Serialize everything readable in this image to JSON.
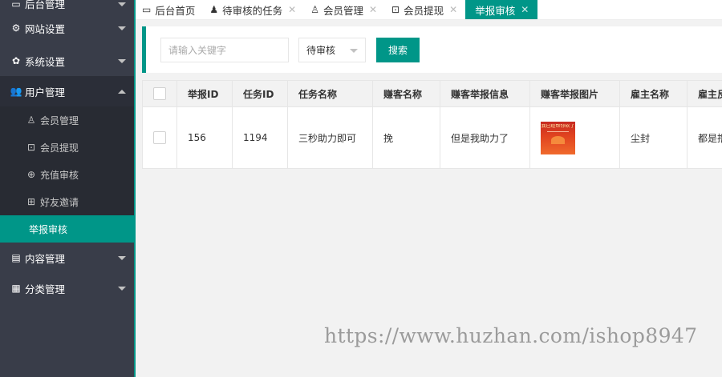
{
  "sidebar": {
    "items": [
      {
        "label": "后台管理",
        "icon": "monitor-icon"
      },
      {
        "label": "网站设置",
        "icon": "gears-icon"
      },
      {
        "label": "系统设置",
        "icon": "gear-icon"
      },
      {
        "label": "用户管理",
        "icon": "users-icon"
      },
      {
        "label": "内容管理",
        "icon": "document-icon"
      },
      {
        "label": "分类管理",
        "icon": "grid-icon"
      }
    ],
    "user_sub": [
      {
        "label": "会员管理",
        "icon": "user-icon"
      },
      {
        "label": "会员提现",
        "icon": "wallet-icon"
      },
      {
        "label": "充值审核",
        "icon": "yen-icon"
      },
      {
        "label": "好友邀请",
        "icon": "gift-icon"
      },
      {
        "label": "举报审核",
        "icon": ""
      }
    ]
  },
  "tabs": [
    {
      "label": "后台首页",
      "icon": "monitor-icon"
    },
    {
      "label": "待审核的任务",
      "icon": "user-icon"
    },
    {
      "label": "会员管理",
      "icon": "user-outline-icon"
    },
    {
      "label": "会员提现",
      "icon": "wallet-icon"
    },
    {
      "label": "举报审核",
      "icon": ""
    }
  ],
  "filter": {
    "keyword_placeholder": "请输入关键字",
    "keyword_value": "",
    "status_selected": "待审核",
    "search_label": "搜索"
  },
  "table": {
    "headers": [
      "举报ID",
      "任务ID",
      "任务名称",
      "赚客名称",
      "赚客举报信息",
      "赚客举报图片",
      "雇主名称",
      "雇主反"
    ],
    "rows": [
      {
        "report_id": "156",
        "task_id": "1194",
        "task_name": "三秒助力即可",
        "earner_name": "挽",
        "report_info": "但是我助力了",
        "image_title": "我已经帮你砍了",
        "employer_name": "尘封",
        "employer_reply": "都是撸"
      }
    ]
  },
  "watermark": "https://www.huzhan.com/ishop8947",
  "colors": {
    "accent": "#009688",
    "sidebar_bg": "#393d49",
    "content_bg": "#f2f2f2"
  }
}
